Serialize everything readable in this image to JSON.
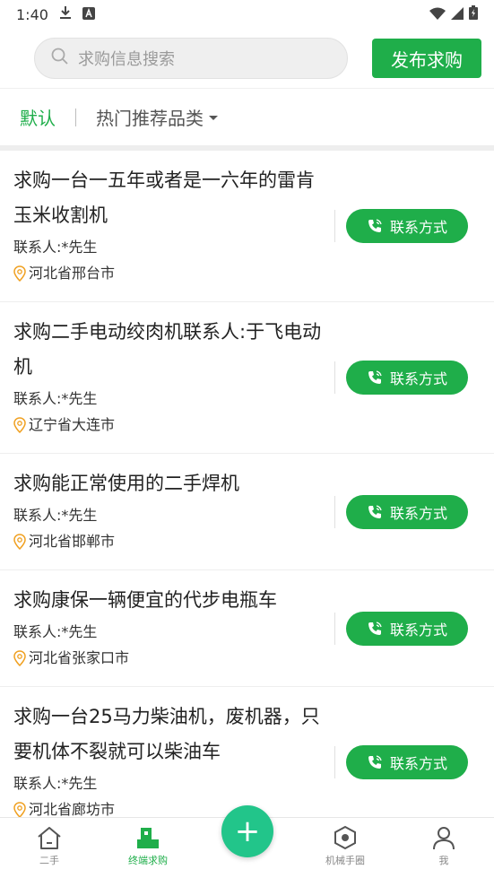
{
  "status_bar": {
    "time": "1:40"
  },
  "header": {
    "search_placeholder": "求购信息搜索",
    "publish_label": "发布求购"
  },
  "filter": {
    "default_label": "默认",
    "category_label": "热门推荐品类"
  },
  "items": [
    {
      "title": "求购一台一五年或者是一六年的雷肯玉米收割机",
      "contact": "联系人:*先生",
      "location": "河北省邢台市",
      "button": "联系方式"
    },
    {
      "title": "求购二手电动绞肉机联系人:于飞电动机",
      "contact": "联系人:*先生",
      "location": "辽宁省大连市",
      "button": "联系方式"
    },
    {
      "title": "求购能正常使用的二手焊机",
      "contact": "联系人:*先生",
      "location": "河北省邯郸市",
      "button": "联系方式"
    },
    {
      "title": "求购康保一辆便宜的代步电瓶车",
      "contact": "联系人:*先生",
      "location": "河北省张家口市",
      "button": "联系方式"
    },
    {
      "title": "求购一台25马力柴油机，废机器，只要机体不裂就可以柴油车",
      "contact": "联系人:*先生",
      "location": "河北省廊坊市",
      "button": "联系方式"
    }
  ],
  "nav": {
    "home": "二手",
    "purchase": "终端求购",
    "fab": "+",
    "machinery": "机械手圈",
    "me": "我"
  },
  "colors": {
    "accent": "#1fae4a",
    "fab": "#22c58a",
    "location_icon": "#f0a020"
  }
}
